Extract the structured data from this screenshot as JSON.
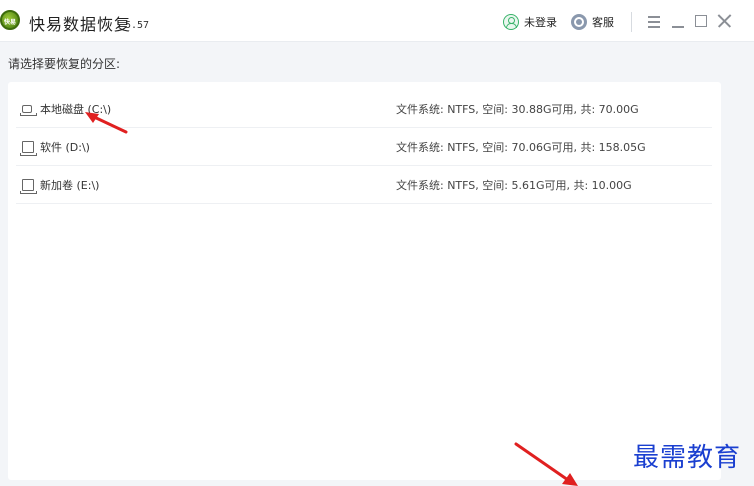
{
  "app": {
    "title": "快易数据恢复",
    "version": "5.57",
    "logo_text": "快易"
  },
  "titlebar": {
    "user_label": "未登录",
    "service_label": "客服",
    "buttons": [
      "menu-icon",
      "minimize-icon",
      "maximize-icon",
      "close-icon"
    ]
  },
  "main": {
    "section_label": "请选择要恢复的分区:",
    "partitions": [
      {
        "name": "本地磁盘 (C:\\)",
        "info": "文件系统: NTFS, 空间: 30.88G可用, 共: 70.00G",
        "icon": "system-drive-icon"
      },
      {
        "name": "软件 (D:\\)",
        "info": "文件系统: NTFS, 空间: 70.06G可用, 共: 158.05G",
        "icon": "drive-icon"
      },
      {
        "name": "新加卷 (E:\\)",
        "info": "文件系统: NTFS, 空间: 5.61G可用, 共: 10.00G",
        "icon": "drive-icon"
      }
    ]
  },
  "watermark": "最需教育",
  "colors": {
    "accent_green": "#39b36a",
    "annotation_red": "#e02020",
    "watermark_blue": "#1a3fd0",
    "background": "#f3f5f8"
  }
}
